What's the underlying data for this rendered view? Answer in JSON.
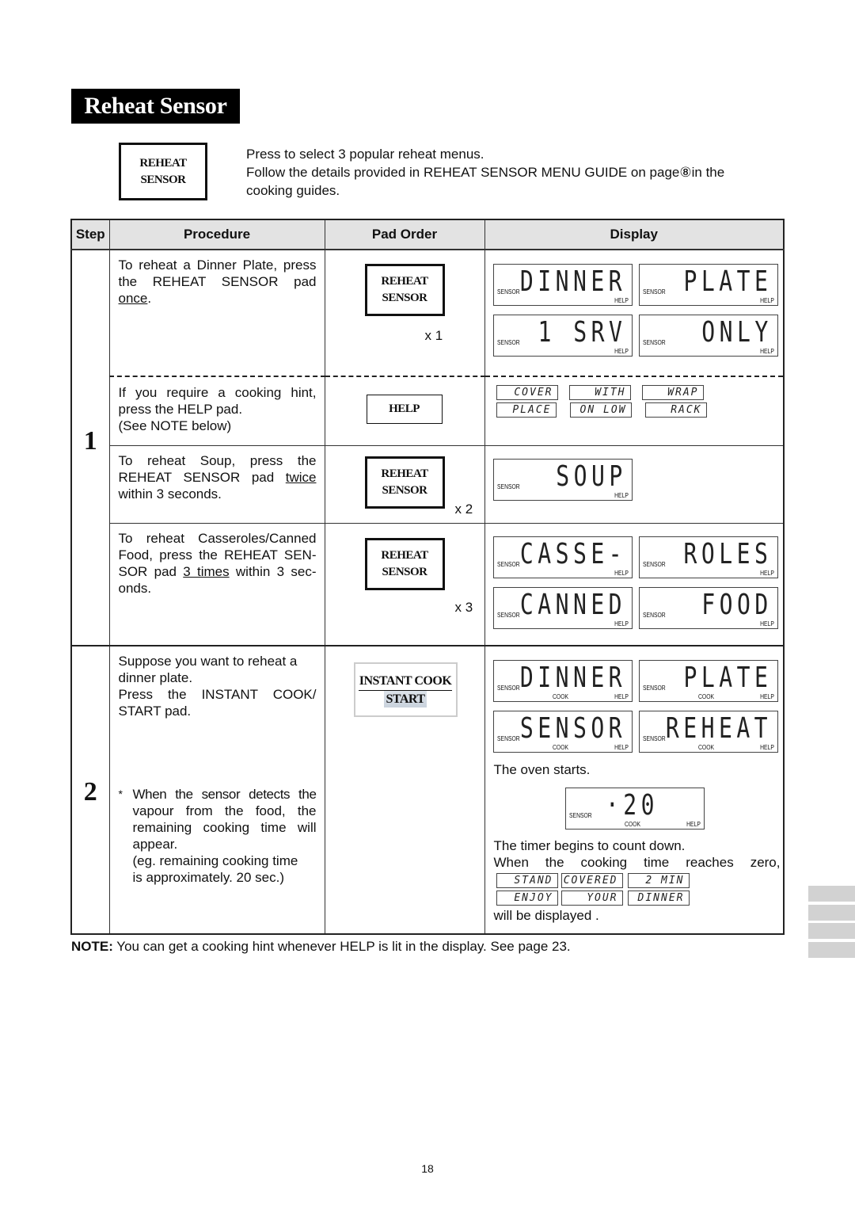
{
  "title": "Reheat Sensor",
  "intro": {
    "pad_label_line1": "REHEAT",
    "pad_label_line2": "SENSOR",
    "line1": "Press to select 3 popular reheat menus.",
    "line2": "Follow the details provided in REHEAT SENSOR MENU GUIDE on page⑧in the",
    "line3": "cooking guides."
  },
  "table": {
    "headers": [
      "Step",
      "Procedure",
      "Pad Order",
      "Display"
    ],
    "step1": {
      "number": "1",
      "rows": [
        {
          "procedure_pre": "To reheat a Dinner Plate, press the REHEAT SENSOR pad ",
          "procedure_u": "once",
          "procedure_post": ".",
          "pad": [
            "REHEAT",
            "SENSOR"
          ],
          "times": "x 1",
          "displays": [
            {
              "text": "DINNER",
              "sensor": "SENSOR",
              "help": "HELP"
            },
            {
              "text": "PLATE",
              "sensor": "SENSOR",
              "help": "HELP"
            },
            {
              "text": "1 SRV",
              "sensor": "SENSOR",
              "help": "HELP"
            },
            {
              "text": "ONLY",
              "sensor": "SENSOR",
              "help": "HELP"
            }
          ]
        },
        {
          "procedure_lines": [
            "If you require a cooking hint,",
            "press the HELP pad.",
            "(See NOTE below)"
          ],
          "pad": "HELP",
          "hints": [
            "COVER",
            "WITH",
            "WRAP",
            "PLACE",
            "ON LOW",
            "RACK"
          ]
        },
        {
          "procedure_pre": "To reheat Soup, press the REHEAT SENSOR pad ",
          "procedure_u": "twice",
          "procedure_post": " within 3 seconds.",
          "pad": [
            "REHEAT",
            "SENSOR"
          ],
          "times": "x 2",
          "displays": [
            {
              "text": "SOUP",
              "sensor": "SENSOR",
              "help": "HELP"
            }
          ]
        },
        {
          "procedure_pre": "To reheat Casseroles/Canned Food, press the REHEAT SEN-SOR pad ",
          "procedure_u": "3 times",
          "procedure_post": " within 3 sec-onds.",
          "pad": [
            "REHEAT",
            "SENSOR"
          ],
          "times": "x 3",
          "displays": [
            {
              "text": "CASSE-",
              "sensor": "SENSOR",
              "help": "HELP"
            },
            {
              "text": "ROLES",
              "sensor": "SENSOR",
              "help": "HELP"
            },
            {
              "text": "CANNED",
              "sensor": "SENSOR",
              "help": "HELP"
            },
            {
              "text": "FOOD",
              "sensor": "SENSOR",
              "help": "HELP"
            }
          ]
        }
      ]
    },
    "step2": {
      "number": "2",
      "procedure_lines": [
        "Suppose you want to reheat a",
        "dinner plate.",
        "Press the INSTANT COOK/",
        "START pad."
      ],
      "note_star": "*",
      "note_lines": [
        "When the sensor detects the",
        "vapour from the food, the",
        "remaining cooking time will",
        "appear.",
        "(eg. remaining cooking time",
        "is approximately. 20 sec.)"
      ],
      "pad_top": "INSTANT COOK",
      "pad_bottom": "START",
      "displays": [
        {
          "text": "DINNER",
          "sensor": "SENSOR",
          "cook": "COOK",
          "help": "HELP"
        },
        {
          "text": "PLATE",
          "sensor": "SENSOR",
          "cook": "COOK",
          "help": "HELP"
        },
        {
          "text": "SENSOR",
          "sensor": "SENSOR",
          "cook": "COOK",
          "help": "HELP"
        },
        {
          "text": "REHEAT",
          "sensor": "SENSOR",
          "cook": "COOK",
          "help": "HELP"
        }
      ],
      "oven_starts": "The oven starts.",
      "timer_display": {
        "text": "·20",
        "sensor": "SENSOR",
        "cook": "COOK",
        "help": "HELP"
      },
      "timer_text": "The timer begins to count down.",
      "zero_text": "When the cooking time reaches zero,",
      "end_messages": [
        "STAND",
        "COVERED",
        "2 MIN",
        "ENJOY",
        "YOUR",
        "DINNER"
      ],
      "displayed_text": "will be displayed ."
    }
  },
  "note": {
    "label": "NOTE:",
    "text": " You can get a cooking hint whenever HELP is lit in the display. See page 23."
  },
  "page_number": "18"
}
